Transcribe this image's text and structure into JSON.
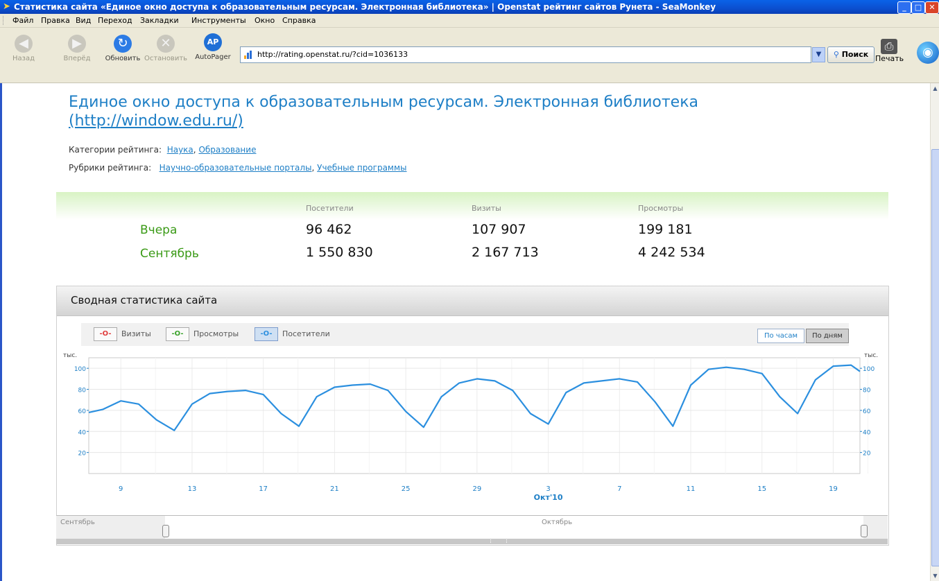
{
  "window": {
    "title": "Статистика сайта «Единое окно доступа к образовательным ресурсам. Электронная библиотека» | Openstat рейтинг сайтов Рунета - SeaMonkey",
    "minimize": "_",
    "maximize": "□",
    "close": "✕"
  },
  "menu": [
    "Файл",
    "Правка",
    "Вид",
    "Переход",
    "Закладки",
    "Инструменты",
    "Окно",
    "Справка"
  ],
  "toolbar": {
    "back": "Назад",
    "forward": "Вперёд",
    "reload": "Обновить",
    "stop": "Остановить",
    "autopager": "AutoPager",
    "url": "http://rating.openstat.ru/?cid=1036133",
    "search": "Поиск",
    "print": "Печать"
  },
  "page": {
    "title": "Единое окно доступа к образовательным ресурсам. Электронная библиотека",
    "site_url": "(http://window.edu.ru/)",
    "categories_label": "Категории рейтинга:",
    "categories": [
      "Наука",
      "Образование"
    ],
    "rubrics_label": "Рубрики рейтинга:",
    "rubrics": [
      "Научно-образовательные порталы",
      "Учебные программы"
    ],
    "separator": ","
  },
  "stats": {
    "headers": [
      "Посетители",
      "Визиты",
      "Просмотры"
    ],
    "rows": [
      {
        "label": "Вчера",
        "values": [
          "96 462",
          "107 907",
          "199 181"
        ]
      },
      {
        "label": "Сентябрь",
        "values": [
          "1 550 830",
          "2 167 713",
          "4 242 534"
        ]
      }
    ]
  },
  "summary": {
    "title": "Сводная статистика сайта",
    "legend": [
      {
        "label": "Визиты",
        "symbol": "-O-",
        "color": "#e03c3c",
        "active": false
      },
      {
        "label": "Просмотры",
        "symbol": "-O-",
        "color": "#3aa22a",
        "active": false
      },
      {
        "label": "Посетители",
        "symbol": "-O-",
        "color": "#2b8fdf",
        "active": true
      }
    ],
    "by_hours": "По часам",
    "by_days": "По дням",
    "scrub_left_month": "Сентябрь",
    "scrub_right_month": "Октябрь"
  },
  "chart_data": {
    "type": "line",
    "unit_label": "тыс.",
    "ylim": [
      0,
      110
    ],
    "y_ticks": [
      20,
      40,
      60,
      80,
      100
    ],
    "x_tick_labels": [
      "9",
      "13",
      "17",
      "21",
      "25",
      "29",
      "3",
      "7",
      "11",
      "15",
      "19"
    ],
    "x_tick_days": [
      2,
      6,
      10,
      14,
      18,
      22,
      26,
      30,
      34,
      38,
      42
    ],
    "month_label": "Окт'10",
    "month_label_day": 26,
    "x_range": [
      0.2,
      43.5
    ],
    "grid": true,
    "series": [
      {
        "name": "Посетители",
        "color": "#2b8fdf",
        "x": [
          0.2,
          1,
          2,
          3,
          4,
          5,
          6,
          7,
          8,
          9,
          10,
          11,
          12,
          13,
          14,
          15,
          16,
          17,
          18,
          19,
          20,
          21,
          22,
          23,
          24,
          25,
          26,
          27,
          28,
          29,
          30,
          31,
          32,
          33,
          34,
          35,
          36,
          37,
          38,
          39,
          40,
          41,
          42,
          43,
          43.5
        ],
        "values": [
          58,
          61,
          69,
          66,
          51,
          41,
          66,
          76,
          78,
          79,
          75,
          57,
          45,
          73,
          82,
          84,
          85,
          79,
          59,
          44,
          73,
          86,
          90,
          88,
          79,
          57,
          47,
          77,
          86,
          88,
          90,
          87,
          68,
          45,
          84,
          99,
          101,
          99,
          95,
          73,
          57,
          89,
          102,
          103,
          97
        ]
      }
    ]
  }
}
